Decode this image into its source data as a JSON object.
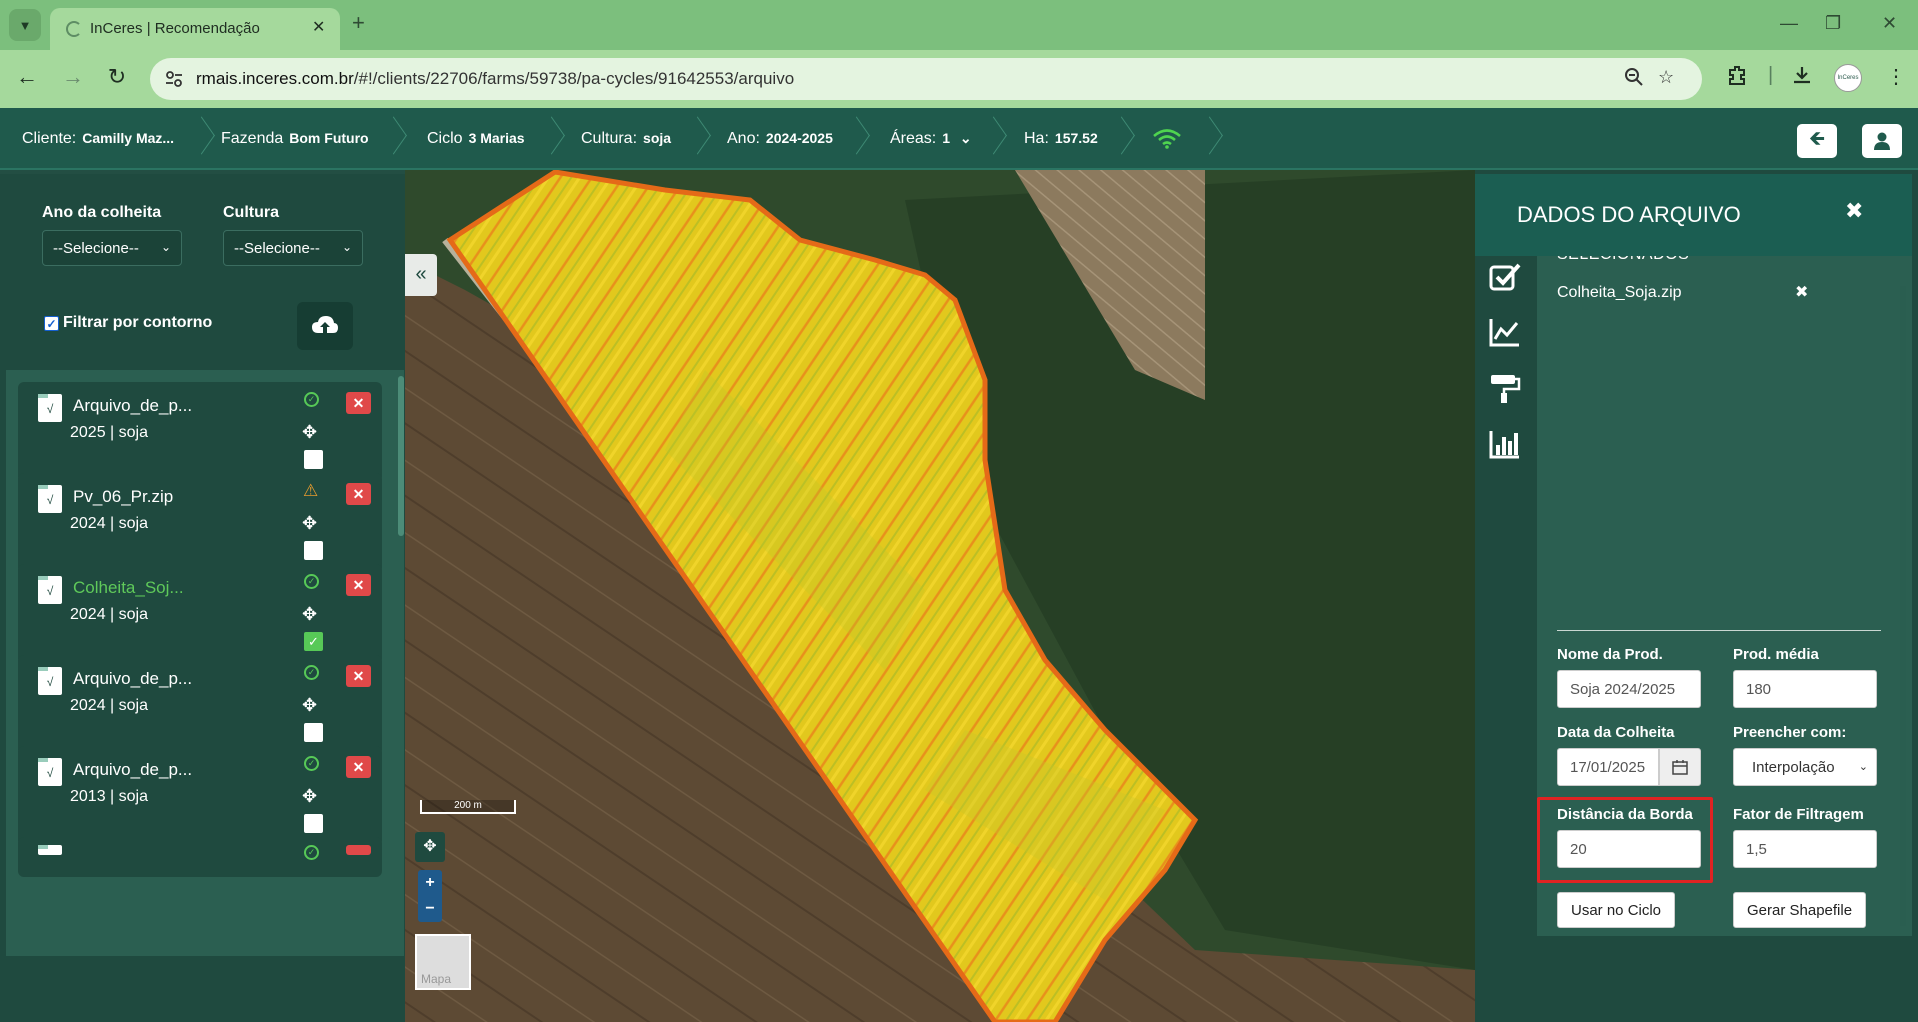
{
  "browser": {
    "tab_title": "InCeres | Recomendação",
    "url_host": "rmais.inceres.com.br",
    "url_path": "/#!/clients/22706/farms/59738/pa-cycles/91642553/arquivo",
    "avatar_text": "InCeres"
  },
  "header": {
    "cliente_label": "Cliente:",
    "cliente_value": "Camilly Maz...",
    "fazenda_label": "Fazenda",
    "fazenda_value": "Bom Futuro",
    "ciclo_label": "Ciclo",
    "ciclo_value": "3 Marias",
    "cultura_label": "Cultura:",
    "cultura_value": "soja",
    "ano_label": "Ano:",
    "ano_value": "2024-2025",
    "areas_label": "Áreas:",
    "areas_value": "1",
    "ha_label": "Ha:",
    "ha_value": "157.52"
  },
  "left_panel": {
    "ano_colheita_label": "Ano da colheita",
    "ano_colheita_value": "--Selecione--",
    "cultura_label": "Cultura",
    "cultura_value": "--Selecione--",
    "filtrar_label": "Filtrar por contorno",
    "filtrar_checked": true,
    "files": [
      {
        "name": "Arquivo_de_p...",
        "meta": "2025 | soja",
        "status": "ok",
        "selected": false
      },
      {
        "name": "Pv_06_Pr.zip",
        "meta": "2024 | soja",
        "status": "warning",
        "selected": false
      },
      {
        "name": "Colheita_Soj...",
        "meta": "2024 | soja",
        "status": "ok",
        "selected": true
      },
      {
        "name": "Arquivo_de_p...",
        "meta": "2024 | soja",
        "status": "ok",
        "selected": false
      },
      {
        "name": "Arquivo_de_p...",
        "meta": "2013 | soja",
        "status": "ok",
        "selected": false
      }
    ]
  },
  "map": {
    "scale_label": "200 m",
    "basemap_label": "Mapa"
  },
  "right_panel": {
    "title": "DADOS DO ARQUIVO",
    "section_cut": "SELECIONADOS",
    "selected_file": "Colheita_Soja.zip",
    "nome_prod_label": "Nome da Prod.",
    "nome_prod_value": "Soja 2024/2025",
    "prod_media_label": "Prod. média",
    "prod_media_value": "180",
    "data_colheita_label": "Data da Colheita",
    "data_colheita_value": "17/01/2025",
    "preencher_label": "Preencher com:",
    "preencher_value": "Interpolação",
    "distancia_label": "Distância da Borda",
    "distancia_value": "20",
    "fator_label": "Fator de Filtragem",
    "fator_value": "1,5",
    "usar_btn": "Usar no Ciclo",
    "gerar_btn": "Gerar Shapefile"
  },
  "colors": {
    "app_header": "#1f5a4c",
    "panel": "#1f4a3f",
    "highlight": "#e02323",
    "ok": "#57c957",
    "warn": "#e59a2f",
    "delete": "#e04949"
  }
}
